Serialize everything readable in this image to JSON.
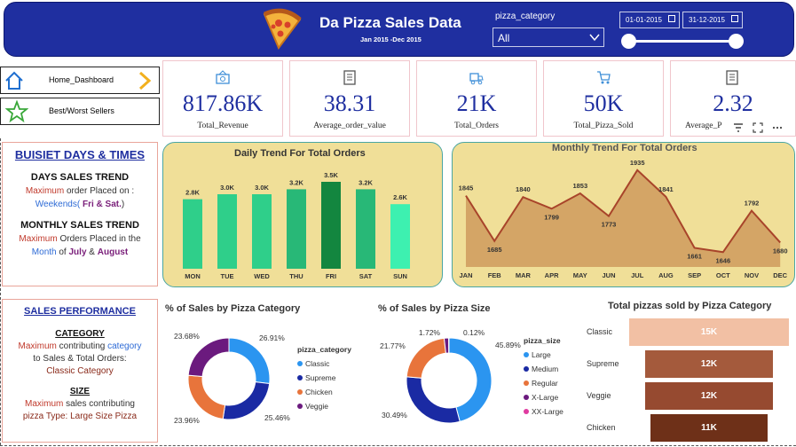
{
  "header": {
    "title": "Da Pizza Sales Data",
    "subtitle": "Jan 2015 -Dec 2015",
    "slicer_label": "pizza_category",
    "slicer_value": "All",
    "date_start": "01-01-2015",
    "date_end": "31-12-2015"
  },
  "sidebar": {
    "items": [
      {
        "label": "Home_Dashboard"
      },
      {
        "label": "Best/Worst Sellers"
      }
    ]
  },
  "kpis": [
    {
      "value": "817.86K",
      "label": "Total_Revenue"
    },
    {
      "value": "38.31",
      "label": "Average_order_value"
    },
    {
      "value": "21K",
      "label": "Total_Orders"
    },
    {
      "value": "50K",
      "label": "Total_Pizza_Sold"
    },
    {
      "value": "2.32",
      "label": "Average_P"
    }
  ],
  "busiest": {
    "title": "BUISIET DAYS & TIMES",
    "days_heading": "DAYS SALES TREND",
    "days_l1_a": "Maximum",
    "days_l1_b": " order Placed on :",
    "days_l2_a": "Weekends(",
    "days_l2_b": " Fri & Sat.",
    "days_l2_c": ")",
    "monthly_heading": "MONTHLY SALES TREND",
    "monthly_l1_a": "Maximum",
    "monthly_l1_b": " Orders Placed in the",
    "monthly_l2_a": "Month",
    "monthly_l2_b": " of ",
    "monthly_l2_c": " July",
    "monthly_l2_d": " & ",
    "monthly_l2_e": "August"
  },
  "performance": {
    "title": "SALES PERFORMANCE",
    "cat_heading": "CATEGORY",
    "cat_l1_a": "Maximum",
    "cat_l1_b": " contributing ",
    "cat_l1_c": "category",
    "cat_l2": "to Sales & Total Orders:",
    "cat_l3": "Classic Category",
    "size_heading": "SIZE",
    "size_l1_a": "Maximum",
    "size_l1_b": " sales contributing",
    "size_l2": "pizza Type: Large Size Pizza"
  },
  "colors": {
    "header": "#1f2fa0",
    "kpi_value": "#1f2fa0",
    "emphasis_red": "#c0392b",
    "emphasis_blue": "#2e6bd6",
    "emphasis_purple": "#7a1f7a"
  },
  "chart_data": [
    {
      "type": "bar",
      "title": "Daily Trend For Total Orders",
      "categories": [
        "MON",
        "TUE",
        "WED",
        "THU",
        "FRI",
        "SAT",
        "SUN"
      ],
      "values": [
        2.8,
        3.0,
        3.0,
        3.2,
        3.5,
        3.2,
        2.6
      ],
      "value_labels": [
        "2.8K",
        "3.0K",
        "3.0K",
        "3.2K",
        "3.5K",
        "3.2K",
        "2.6K"
      ],
      "colors": [
        "#2fcf8a",
        "#2fcf8a",
        "#2fcf8a",
        "#28b877",
        "#13863f",
        "#28b877",
        "#3df0b0"
      ]
    },
    {
      "type": "area",
      "title": "Monthly Trend For Total Orders",
      "categories": [
        "JAN",
        "FEB",
        "MAR",
        "APR",
        "MAY",
        "JUN",
        "JUL",
        "AUG",
        "SEP",
        "OCT",
        "NOV",
        "DEC"
      ],
      "values": [
        1845,
        1685,
        1840,
        1799,
        1853,
        1773,
        1935,
        1841,
        1661,
        1646,
        1792,
        1680
      ],
      "ylim": [
        1600,
        1950
      ],
      "fill": "#d4a566",
      "stroke": "#a8442a"
    },
    {
      "type": "pie",
      "title": "% of Sales by Pizza Category",
      "legend_title": "pizza_category",
      "labels": [
        "Classic",
        "Supreme",
        "Chicken",
        "Veggie"
      ],
      "values": [
        26.91,
        25.46,
        23.96,
        23.68
      ],
      "value_labels": [
        "26.91%",
        "25.46%",
        "23.96%",
        "23.68%"
      ],
      "colors": [
        "#2b95f0",
        "#1a2aa3",
        "#e8743b",
        "#6b1a7e"
      ]
    },
    {
      "type": "pie",
      "title": "% of Sales by Pizza Size",
      "legend_title": "pizza_size",
      "labels": [
        "Large",
        "Medium",
        "Regular",
        "X-Large",
        "XX-Large"
      ],
      "values": [
        45.89,
        30.49,
        21.77,
        1.72,
        0.12
      ],
      "value_labels": [
        "45.89%",
        "30.49%",
        "21.77%",
        "1.72%",
        "0.12%"
      ],
      "colors": [
        "#2b95f0",
        "#1a2aa3",
        "#e8743b",
        "#6b1a7e",
        "#e03aa0"
      ]
    },
    {
      "type": "bar",
      "title": "Total pizzas sold by Pizza Category",
      "categories": [
        "Classic",
        "Supreme",
        "Veggie",
        "Chicken"
      ],
      "values": [
        15,
        12,
        12,
        11
      ],
      "value_labels": [
        "15K",
        "12K",
        "12K",
        "11K"
      ],
      "colors": [
        "#f2c0a4",
        "#a45a3c",
        "#964a30",
        "#6e3018"
      ]
    }
  ]
}
